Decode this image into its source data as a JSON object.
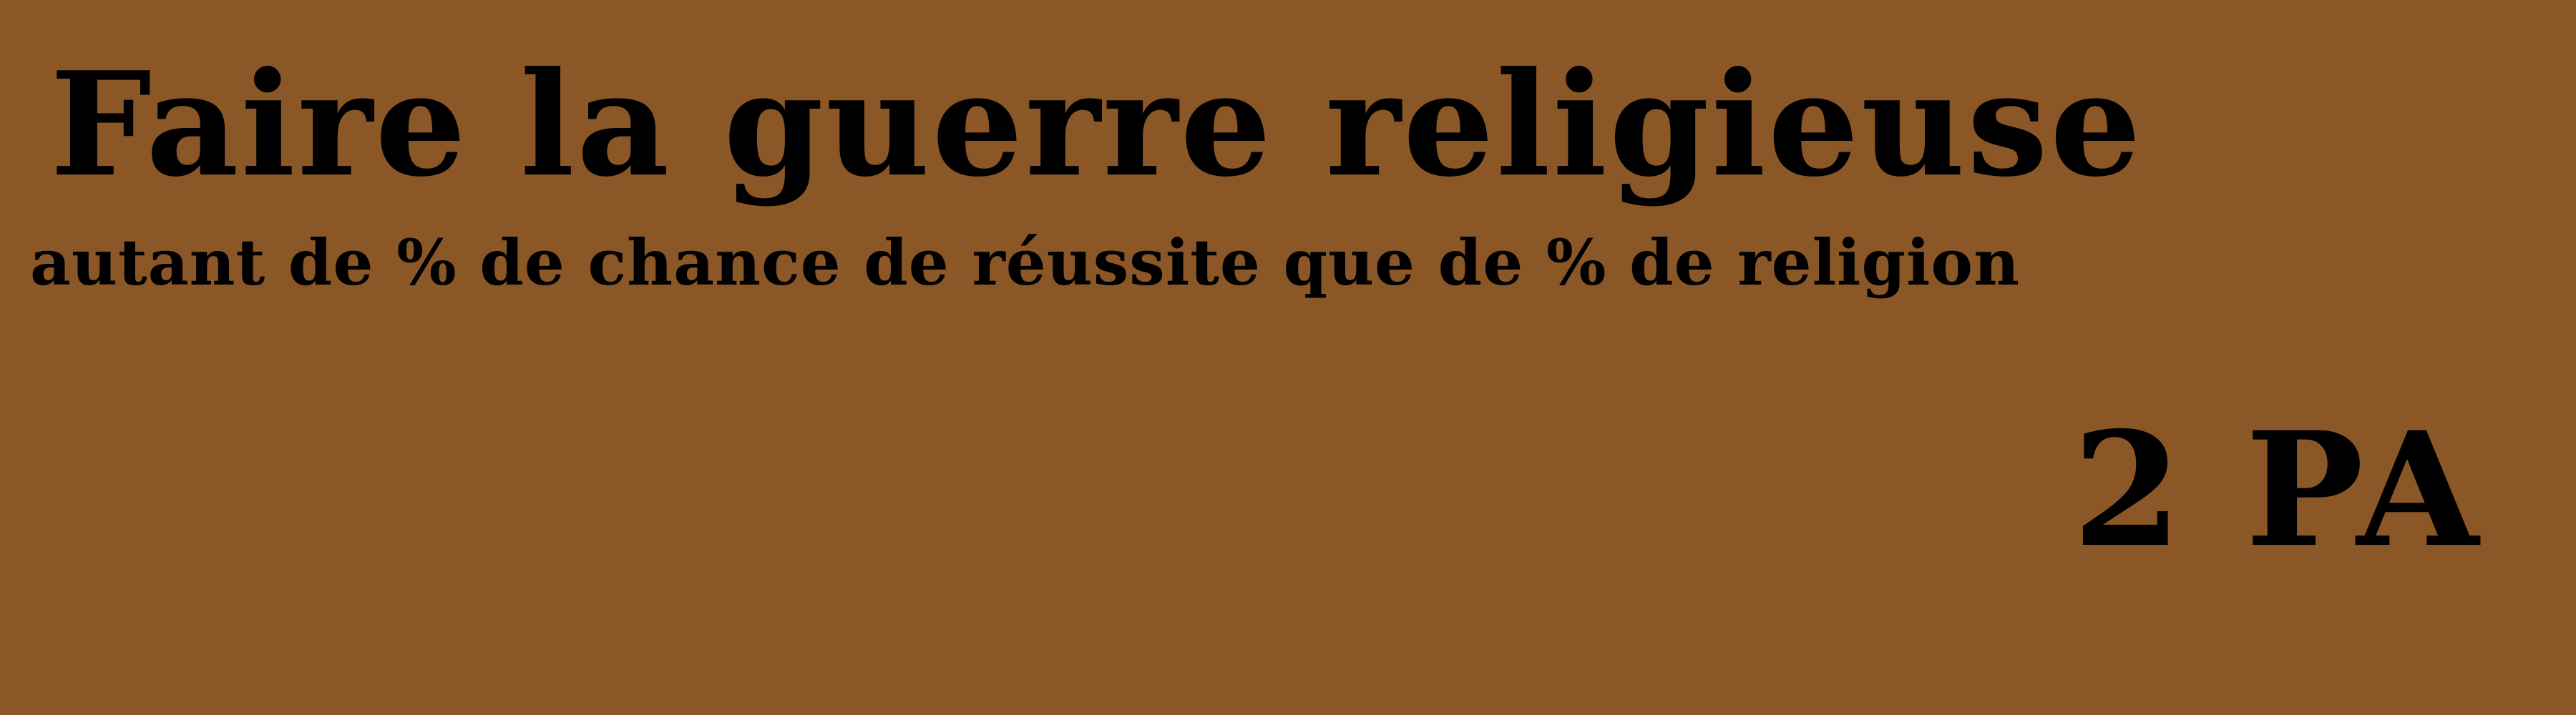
{
  "card": {
    "title": "Faire la guerre religieuse",
    "description": "autant de % de chance de réussite que de % de religion",
    "cost": "2 PA",
    "background_color": "#8B5726",
    "text_color": "#000000"
  }
}
